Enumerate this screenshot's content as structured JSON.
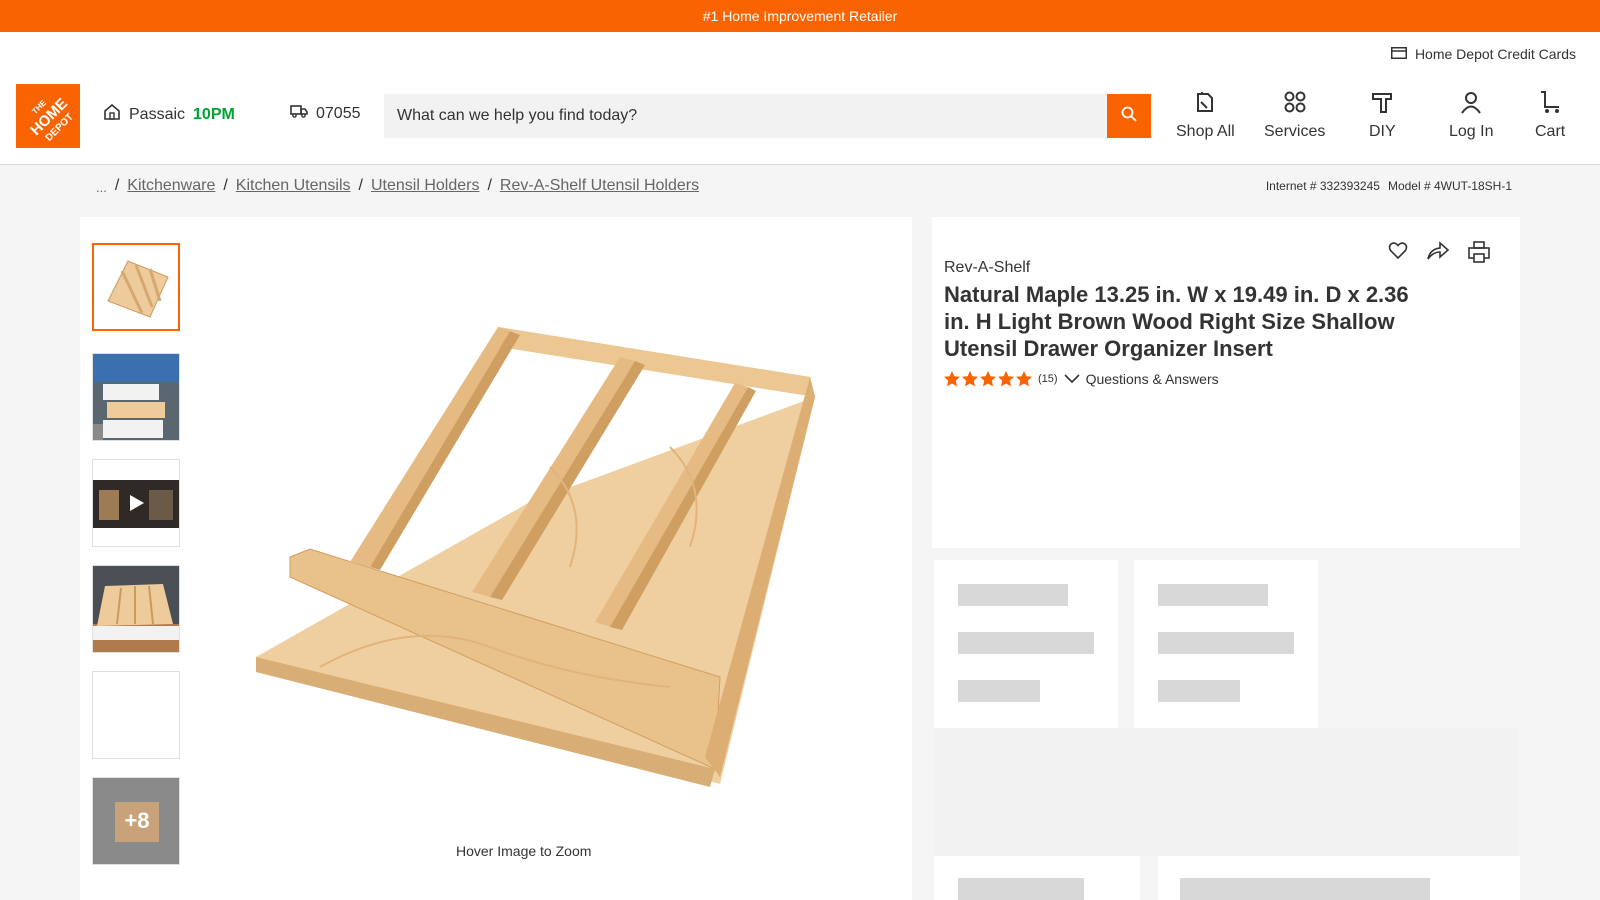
{
  "promo": {
    "text": "#1 Home Improvement Retailer"
  },
  "header": {
    "credit_cards": "Home Depot Credit Cards",
    "logo_text": "THE HOME DEPOT",
    "store": {
      "name": "Passaic",
      "hours": "10PM"
    },
    "delivery_zip": "07055",
    "search": {
      "placeholder": "What can we help you find today?"
    },
    "nav": {
      "shop_all": "Shop All",
      "services": "Services",
      "diy": "DIY",
      "login": "Log In",
      "cart": "Cart"
    }
  },
  "breadcrumbs": {
    "ellipsis": "...",
    "items": [
      "Kitchenware",
      "Kitchen Utensils",
      "Utensil Holders",
      "Rev-A-Shelf Utensil Holders"
    ],
    "separator": "/"
  },
  "product_ids": {
    "internet": "Internet # 332393245",
    "model": "Model # 4WUT-18SH-1"
  },
  "gallery": {
    "more_count": "+8",
    "zoom_hint": "Hover Image to Zoom"
  },
  "product": {
    "brand": "Rev-A-Shelf",
    "title": "Natural Maple 13.25 in. W x 19.49 in. D x 2.36 in. H Light Brown Wood Right Size Shallow Utensil Drawer Organizer Insert",
    "rating": 5,
    "review_count": "(15)",
    "qa_label": "Questions & Answers"
  },
  "colors": {
    "brand_orange": "#f96302",
    "open_green": "#00a330"
  }
}
